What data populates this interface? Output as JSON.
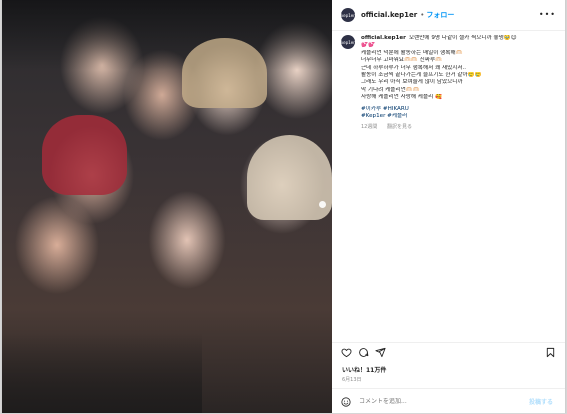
{
  "post": {
    "username": "official.kep1er",
    "avatar_text": "kep1er",
    "separator": "•",
    "follow_label": "フォロー",
    "more_label": "•••"
  },
  "caption": {
    "username": "official.kep1er",
    "lines": [
      "오랜만에 9명 다같이 셀카 찍으니까 좋넹🥹😊",
      "💕💕",
      "케플리언 덕분에 활동하는 매일이 행복해🫶🏻",
      "너무너무 고마워요🫶🏻🫶🏻 진짜루🫶🏻",
      "근데 하루하루가 너무 행복해서 꽤 재밌지서..",
      "활동이 조금씩 끝나가는게 슬프기도 한거 같아🥲🥲",
      "그래도 우리 아직 보여줄게 많이 남았으니까",
      "막 기다려 케플리언🫶🏻🫶🏻",
      "사랑해 케플리언 사랑해 케플리 🥰"
    ],
    "hashtags": [
      "#이카루 #HIKARU",
      "#Kep1er #케플러"
    ],
    "meta_time": "12週間",
    "meta_translate": "翻訳を見る"
  },
  "stats": {
    "likes": "いいね！11万件",
    "date": "6月13日"
  },
  "comment": {
    "placeholder": "コメントを追加...",
    "post_label": "投稿する"
  },
  "icons": [
    "more-icon",
    "heart-icon",
    "comment-icon",
    "share-icon",
    "bookmark-icon",
    "emoji-icon"
  ],
  "colors": {
    "follow": "#0095f6",
    "hashtag": "#00376b",
    "meta": "#8e8e8e",
    "post_disabled": "#b2dffc"
  }
}
